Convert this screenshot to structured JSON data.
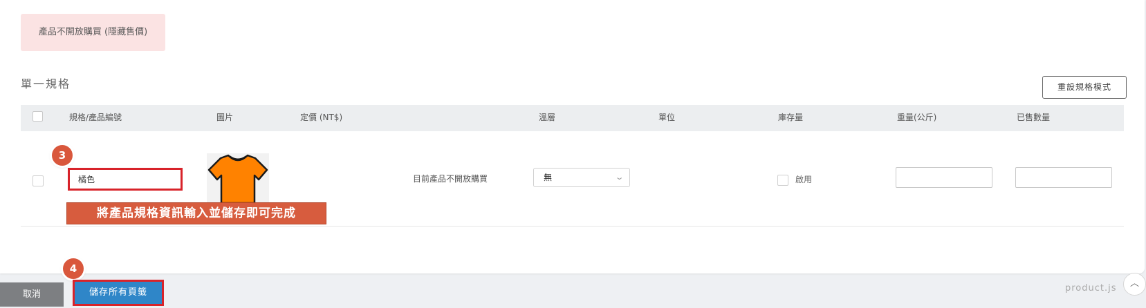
{
  "notice": {
    "text": "產品不開放購買 (隱藏售價)"
  },
  "section": {
    "title": "單一規格",
    "reset_button": "重設規格模式"
  },
  "table": {
    "headers": [
      "規格/產品編號",
      "圖片",
      "定價 (NT$)",
      "溫層",
      "單位",
      "庫存量",
      "重量(公斤)",
      "已售數量"
    ],
    "row": {
      "spec_value": "橘色",
      "image_icon": "orange-tshirt-icon",
      "status_text": "目前產品不開放購買",
      "temperature_value": "無",
      "enable_label": "啟用",
      "weight_value": "",
      "sold_value": ""
    }
  },
  "annotations": {
    "step3": "3",
    "step4": "4",
    "callout": "將產品規格資訊輸入並儲存即可完成",
    "highlight_color": "#d8232a",
    "badge_color": "#d9573c"
  },
  "footer": {
    "cancel_label": "取消",
    "save_label": "儲存所有頁籤",
    "file_label": "product.js",
    "scroll_top_icon": "chevron-up-icon"
  },
  "colors": {
    "primary": "#2f86c8",
    "cancel": "#7d7f82",
    "notice_bg": "#fbe3e3",
    "shirt": "#ff8200"
  }
}
